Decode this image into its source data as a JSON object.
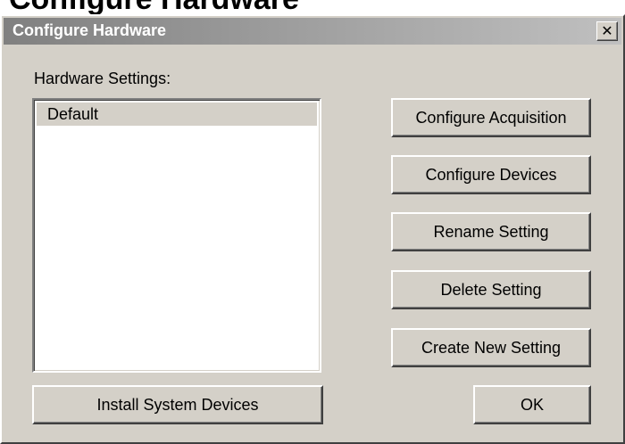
{
  "window": {
    "title": "Configure Hardware",
    "behind_title_fragment": "Configure Hardware",
    "close_glyph": "✕"
  },
  "hardware_settings": {
    "label": "Hardware Settings:",
    "items": [
      "Default"
    ],
    "selected_index": 0
  },
  "buttons": {
    "configure_acquisition": "Configure Acquisition",
    "configure_devices": "Configure Devices",
    "rename_setting": "Rename Setting",
    "delete_setting": "Delete Setting",
    "create_new_setting": "Create New Setting",
    "install_system_devices": "Install System Devices",
    "ok": "OK"
  },
  "colors": {
    "dialog_face": "#d4d0c8",
    "title_gradient_start": "#808080",
    "title_gradient_end": "#c0c0c0",
    "selection_highlight": "#d4d0c8"
  }
}
